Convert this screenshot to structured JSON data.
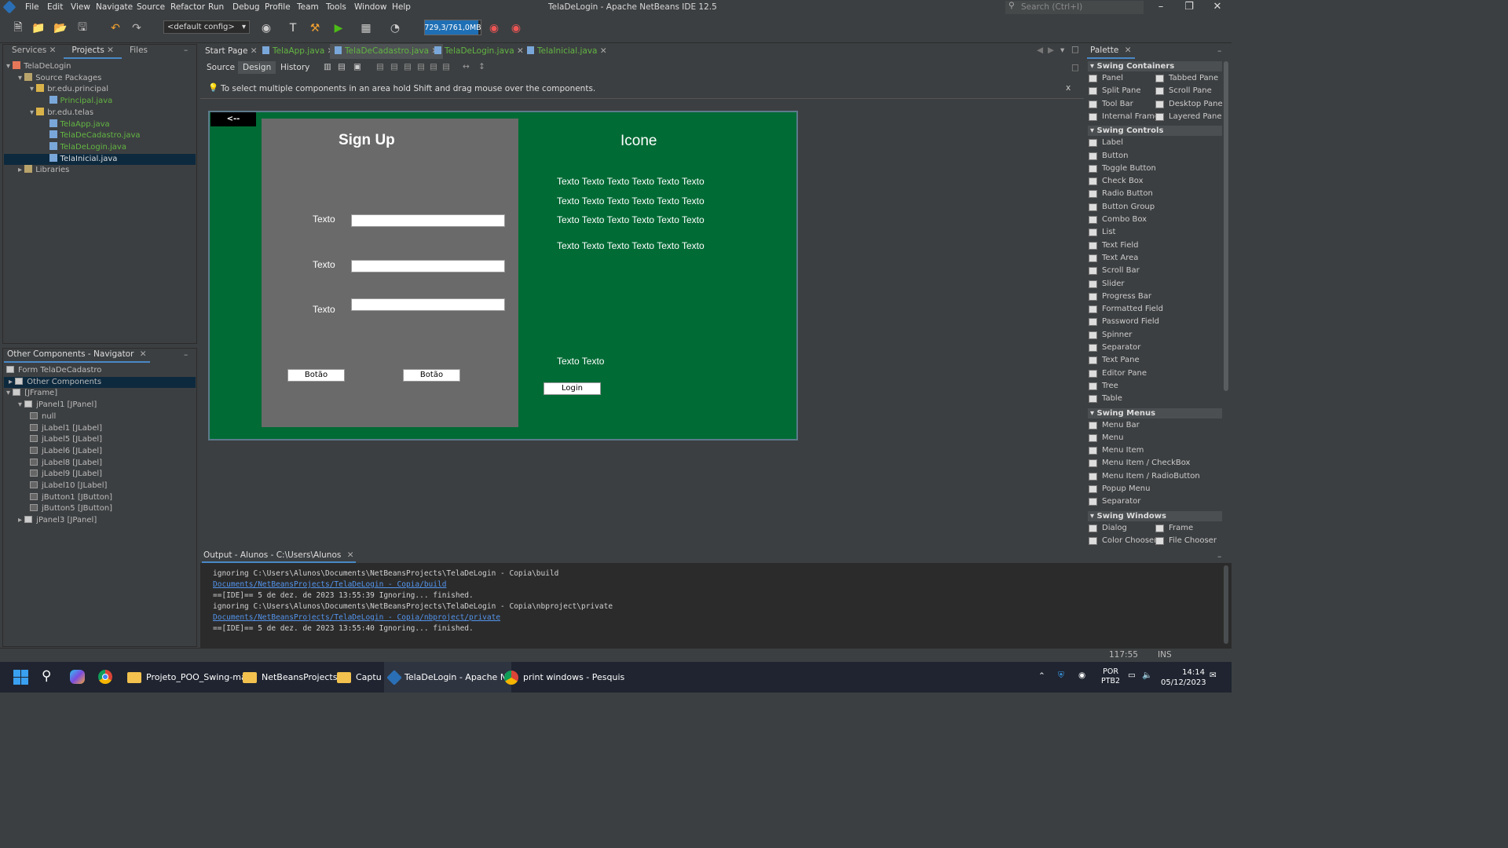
{
  "title_bar": {
    "menu": [
      "File",
      "Edit",
      "View",
      "Navigate",
      "Source",
      "Refactor",
      "Run",
      "Debug",
      "Profile",
      "Team",
      "Tools",
      "Window",
      "Help"
    ],
    "window_title": "TelaDeLogin - Apache NetBeans IDE 12.5",
    "search_placeholder": "Search (Ctrl+I)"
  },
  "toolbar": {
    "config": "<default config>",
    "memory": "729,3/761,0MB",
    "memory_fraction": 0.96
  },
  "left_panel": {
    "tabs": [
      "Services",
      "Projects",
      "Files"
    ],
    "tree": [
      {
        "label": "TelaDeLogin",
        "depth": 0,
        "icon": "project-icon"
      },
      {
        "label": "Source Packages",
        "depth": 1,
        "icon": "source-packages-icon"
      },
      {
        "label": "br.edu.principal",
        "depth": 2,
        "icon": "package-icon"
      },
      {
        "label": "Principal.java",
        "depth": 3,
        "icon": "java-file-icon",
        "green": true
      },
      {
        "label": "br.edu.telas",
        "depth": 2,
        "icon": "package-icon"
      },
      {
        "label": "TelaApp.java",
        "depth": 3,
        "icon": "java-file-icon",
        "green": true
      },
      {
        "label": "TelaDeCadastro.java",
        "depth": 3,
        "icon": "java-file-icon",
        "green": true
      },
      {
        "label": "TelaDeLogin.java",
        "depth": 3,
        "icon": "java-file-icon",
        "green": true
      },
      {
        "label": "TelaInicial.java",
        "depth": 3,
        "icon": "java-file-icon",
        "selected": true
      },
      {
        "label": "Libraries",
        "depth": 1,
        "icon": "libraries-icon"
      }
    ]
  },
  "navigator": {
    "title": "Other Components - Navigator",
    "rows": [
      {
        "label": "Form TelaDeCadastro",
        "depth": 0
      },
      {
        "label": "Other Components",
        "depth": 0,
        "selected": true
      },
      {
        "label": "[JFrame]",
        "depth": 0
      },
      {
        "label": "jPanel1 [JPanel]",
        "depth": 1
      },
      {
        "label": "null",
        "depth": 2
      },
      {
        "label": "jLabel1 [JLabel]",
        "depth": 2
      },
      {
        "label": "jLabel5 [JLabel]",
        "depth": 2
      },
      {
        "label": "jLabel6 [JLabel]",
        "depth": 2
      },
      {
        "label": "jLabel8 [JLabel]",
        "depth": 2
      },
      {
        "label": "jLabel9 [JLabel]",
        "depth": 2
      },
      {
        "label": "jLabel10 [JLabel]",
        "depth": 2
      },
      {
        "label": "jButton1 [JButton]",
        "depth": 2
      },
      {
        "label": "jButton5 [JButton]",
        "depth": 2
      },
      {
        "label": "jPanel3 [JPanel]",
        "depth": 1
      }
    ]
  },
  "editor": {
    "tabs": [
      "Start Page",
      "TelaApp.java",
      "TelaDeCadastro.java",
      "TelaDeLogin.java",
      "TelaInicial.java"
    ],
    "active_tab": 2,
    "view_tabs": [
      "Source",
      "Design",
      "History"
    ],
    "hint": "To select multiple components in an area hold Shift and drag mouse over the components.",
    "hint_close": "x"
  },
  "form": {
    "back_button": "<--",
    "signup_title": "Sign Up",
    "field_labels": [
      "Texto",
      "Texto",
      "Texto"
    ],
    "buttons": [
      "Botão",
      "Botão"
    ],
    "icon_label": "Icone",
    "lines": [
      "Texto Texto Texto Texto Texto Texto",
      "Texto Texto Texto Texto Texto Texto",
      "Texto Texto Texto Texto Texto Texto",
      "Texto Texto Texto Texto Texto Texto"
    ],
    "bottom_text": "Texto Texto",
    "login_button": "Login"
  },
  "palette": {
    "title": "Palette",
    "sections": [
      {
        "name": "Swing Containers",
        "items": [
          "Panel",
          "Tabbed Pane",
          "Split Pane",
          "Scroll Pane",
          "Tool Bar",
          "Desktop Pane",
          "Internal Frame",
          "Layered Pane"
        ]
      },
      {
        "name": "Swing Controls",
        "items": [
          "Label",
          "Button",
          "Toggle Button",
          "Check Box",
          "Radio Button",
          "Button Group",
          "Combo Box",
          "List",
          "Text Field",
          "Text Area",
          "Scroll Bar",
          "Slider",
          "Progress Bar",
          "Formatted Field",
          "Password Field",
          "Spinner",
          "Separator",
          "Text Pane",
          "Editor Pane",
          "Tree",
          "Table"
        ]
      },
      {
        "name": "Swing Menus",
        "items": [
          "Menu Bar",
          "Menu",
          "Menu Item",
          "Menu Item / CheckBox",
          "Menu Item / RadioButton",
          "Popup Menu",
          "Separator"
        ]
      },
      {
        "name": "Swing Windows",
        "items": [
          "Dialog",
          "Frame",
          "Color Chooser",
          "File Chooser"
        ]
      }
    ]
  },
  "output": {
    "title": "Output - Alunos - C:\\Users\\Alunos",
    "lines": [
      {
        "text": "ignoring C:\\Users\\Alunos\\Documents\\NetBeansProjects\\TelaDeLogin - Copia\\build",
        "link": false
      },
      {
        "text": "Documents/NetBeansProjects/TelaDeLogin - Copia/build",
        "link": true
      },
      {
        "text": "==[IDE]== 5 de dez. de 2023 13:55:39 Ignoring... finished.",
        "link": false
      },
      {
        "text": "ignoring C:\\Users\\Alunos\\Documents\\NetBeansProjects\\TelaDeLogin - Copia\\nbproject\\private",
        "link": false
      },
      {
        "text": "Documents/NetBeansProjects/TelaDeLogin - Copia/nbproject/private",
        "link": true
      },
      {
        "text": "==[IDE]== 5 de dez. de 2023 13:55:40 Ignoring... finished.",
        "link": false
      }
    ]
  },
  "status": {
    "position": "117:55",
    "mode": "INS"
  },
  "taskbar": {
    "apps": [
      "Projeto_POO_Swing-ma",
      "NetBeansProjects",
      "Captu",
      "TelaDeLogin - Apache N",
      "print windows - Pesquis"
    ],
    "lang": "POR",
    "layout": "PTB2",
    "time": "14:14",
    "date": "05/12/2023"
  }
}
